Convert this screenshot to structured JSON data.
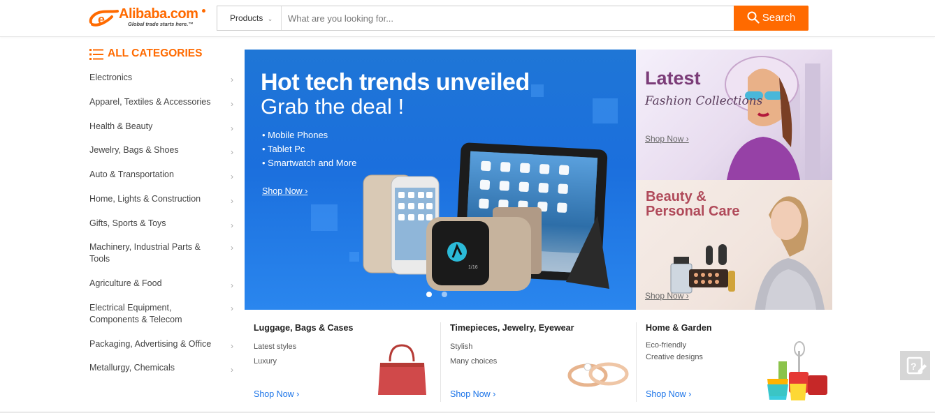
{
  "header": {
    "logo_word": "Alibaba.com",
    "logo_tagline": "Global trade starts here.™",
    "search_category": "Products",
    "search_placeholder": "What are you looking for...",
    "search_button": "Search"
  },
  "sidebar": {
    "title": "ALL CATEGORIES",
    "items": [
      {
        "label": "Electronics"
      },
      {
        "label": "Apparel, Textiles & Accessories"
      },
      {
        "label": "Health & Beauty"
      },
      {
        "label": "Jewelry, Bags & Shoes"
      },
      {
        "label": "Auto & Transportation"
      },
      {
        "label": "Home, Lights & Construction"
      },
      {
        "label": "Gifts, Sports & Toys"
      },
      {
        "label": "Machinery, Industrial Parts & Tools"
      },
      {
        "label": "Agriculture & Food"
      },
      {
        "label": "Electrical Equipment, Components & Telecom"
      },
      {
        "label": "Packaging, Advertising & Office"
      },
      {
        "label": "Metallurgy, Chemicals"
      }
    ]
  },
  "hero": {
    "title": "Hot tech trends unveiled",
    "subtitle": "Grab the deal !",
    "bullets": [
      "Mobile Phones",
      "Tablet Pc",
      "Smartwatch and More"
    ],
    "shop_now": "Shop Now ›",
    "watch_face_text": "1/16"
  },
  "fashion_banner": {
    "title": "Latest",
    "subtitle": "Fashion Collections",
    "shop_now": "Shop Now ›"
  },
  "beauty_banner": {
    "title_line1": "Beauty &",
    "title_line2": "Personal Care",
    "shop_now": "Shop Now ›"
  },
  "promos": [
    {
      "title": "Luggage, Bags & Cases",
      "line1": "Latest styles",
      "line2": "Luxury",
      "shop_now": "Shop Now ›"
    },
    {
      "title": "Timepieces, Jewelry, Eyewear",
      "line1": "Stylish",
      "line2": "Many choices",
      "shop_now": "Shop Now ›"
    },
    {
      "title": "Home & Garden",
      "line1": "Eco-friendly",
      "line2": "Creative designs",
      "shop_now": "Shop Now ›"
    }
  ],
  "colors": {
    "brand_orange": "#ff6a00",
    "hero_blue": "#1b6fdd",
    "link_blue": "#1a73e8"
  }
}
